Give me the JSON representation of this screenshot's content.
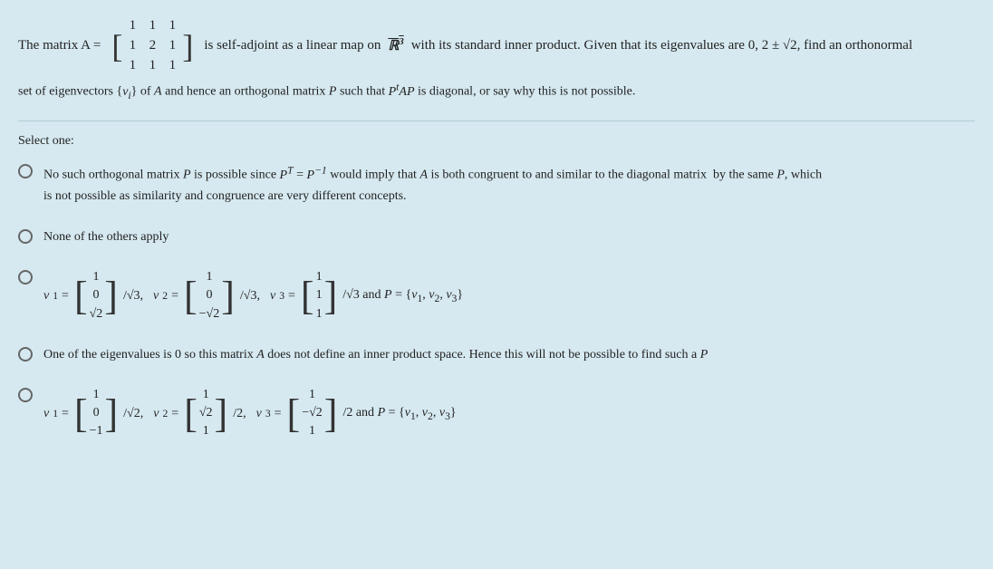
{
  "problem": {
    "intro": "The matrix A =",
    "matrix_A": [
      [
        "1",
        "1",
        "1"
      ],
      [
        "1",
        "2",
        "1"
      ],
      [
        "1",
        "1",
        "1"
      ]
    ],
    "description": "is self-adjoint as a linear map on",
    "R3": "ℝ³",
    "rest": "with its standard inner product. Given that its eigenvalues are 0, 2 ± √2, find an orthonormal",
    "line2": "set of eigenvectors {vᵢ} of A and hence an orthogonal matrix P such that PᵗAP is diagonal, or say why this is not possible."
  },
  "select_one": "Select one:",
  "options": [
    {
      "id": "opt1",
      "text_main": "No such orthogonal matrix P is possible since P",
      "text_sup": "T",
      "text_mid": " = P",
      "text_sup2": "−1",
      "text_end": " would imply that A is both congruent to and similar to the diagonal matrix  by the same P, which",
      "text_line2": "is not possible as similarity and congruence are very different concepts."
    },
    {
      "id": "opt2",
      "text": "None of the others apply"
    },
    {
      "id": "opt3",
      "eigenvec": true,
      "v1_entries": [
        "1",
        "0",
        "√2"
      ],
      "v1_scalar": "/√3,",
      "v2_entries": [
        "1",
        "0",
        "−√2"
      ],
      "v2_scalar": "/√3,",
      "v3_entries": [
        "1",
        "1",
        "1"
      ],
      "v3_scalar": "/√3",
      "P_set": "and P = {v₁, v₂, v₃}"
    },
    {
      "id": "opt4",
      "text": "One of the eigenvalues is 0 so this matrix A does not define an inner product space. Hence this will not be possible to find such a P"
    },
    {
      "id": "opt5",
      "eigenvec2": true,
      "v1_entries": [
        "1",
        "0",
        "−1"
      ],
      "v1_scalar": "/√2,",
      "v2_entries": [
        "1",
        "√2",
        "1"
      ],
      "v2_scalar": "/2,",
      "v3_entries": [
        "1",
        "−√2",
        "1"
      ],
      "v3_scalar": "/2",
      "P_set2": "and P = {v₁, v₂, v₃}"
    }
  ],
  "colors": {
    "accent": "#3a7ca5",
    "radio_border": "#666",
    "bg": "#d6e9f0"
  }
}
